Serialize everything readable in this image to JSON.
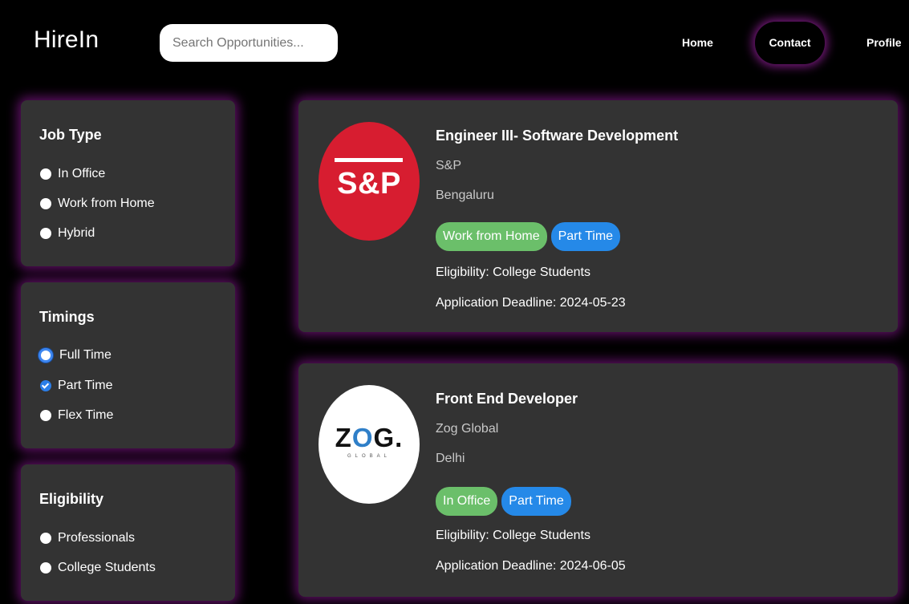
{
  "app": {
    "title": "HireIn"
  },
  "search": {
    "placeholder": "Search Opportunities..."
  },
  "nav": {
    "home": "Home",
    "contact": "Contact",
    "profile": "Profile"
  },
  "filters": {
    "job_type": {
      "title": "Job Type",
      "options": [
        {
          "label": "In Office",
          "checked": false
        },
        {
          "label": "Work from Home",
          "checked": false
        },
        {
          "label": "Hybrid",
          "checked": false
        }
      ]
    },
    "timings": {
      "title": "Timings",
      "options": [
        {
          "label": "Full Time",
          "checked": false,
          "focused": true
        },
        {
          "label": "Part Time",
          "checked": true
        },
        {
          "label": "Flex Time",
          "checked": false
        }
      ]
    },
    "eligibility": {
      "title": "Eligibility",
      "options": [
        {
          "label": "Professionals",
          "checked": false
        },
        {
          "label": "College Students",
          "checked": false
        }
      ]
    }
  },
  "jobs": [
    {
      "title": "Engineer III- Software Development",
      "company": "S&P",
      "location": "Bengaluru",
      "logo_text": "S&P",
      "tags": [
        "Work from Home",
        "Part Time"
      ],
      "eligibility": "Eligibility: College Students",
      "deadline": "Application Deadline: 2024-05-23"
    },
    {
      "title": "Front End Developer",
      "company": "Zog Global",
      "location": "Delhi",
      "logo_text_left": "Z",
      "logo_text_hex": "O",
      "logo_text_right": "G.",
      "logo_subtext": "GLOBAL",
      "tags": [
        "In Office",
        "Part Time"
      ],
      "eligibility": "Eligibility: College Students",
      "deadline": "Application Deadline: 2024-06-05"
    }
  ],
  "colors": {
    "background": "#000000",
    "card": "#333333",
    "glow": "#aa1eb4",
    "tag_green": "#6bbf6a",
    "tag_blue": "#2589e8",
    "sp_red": "#d71d30"
  }
}
